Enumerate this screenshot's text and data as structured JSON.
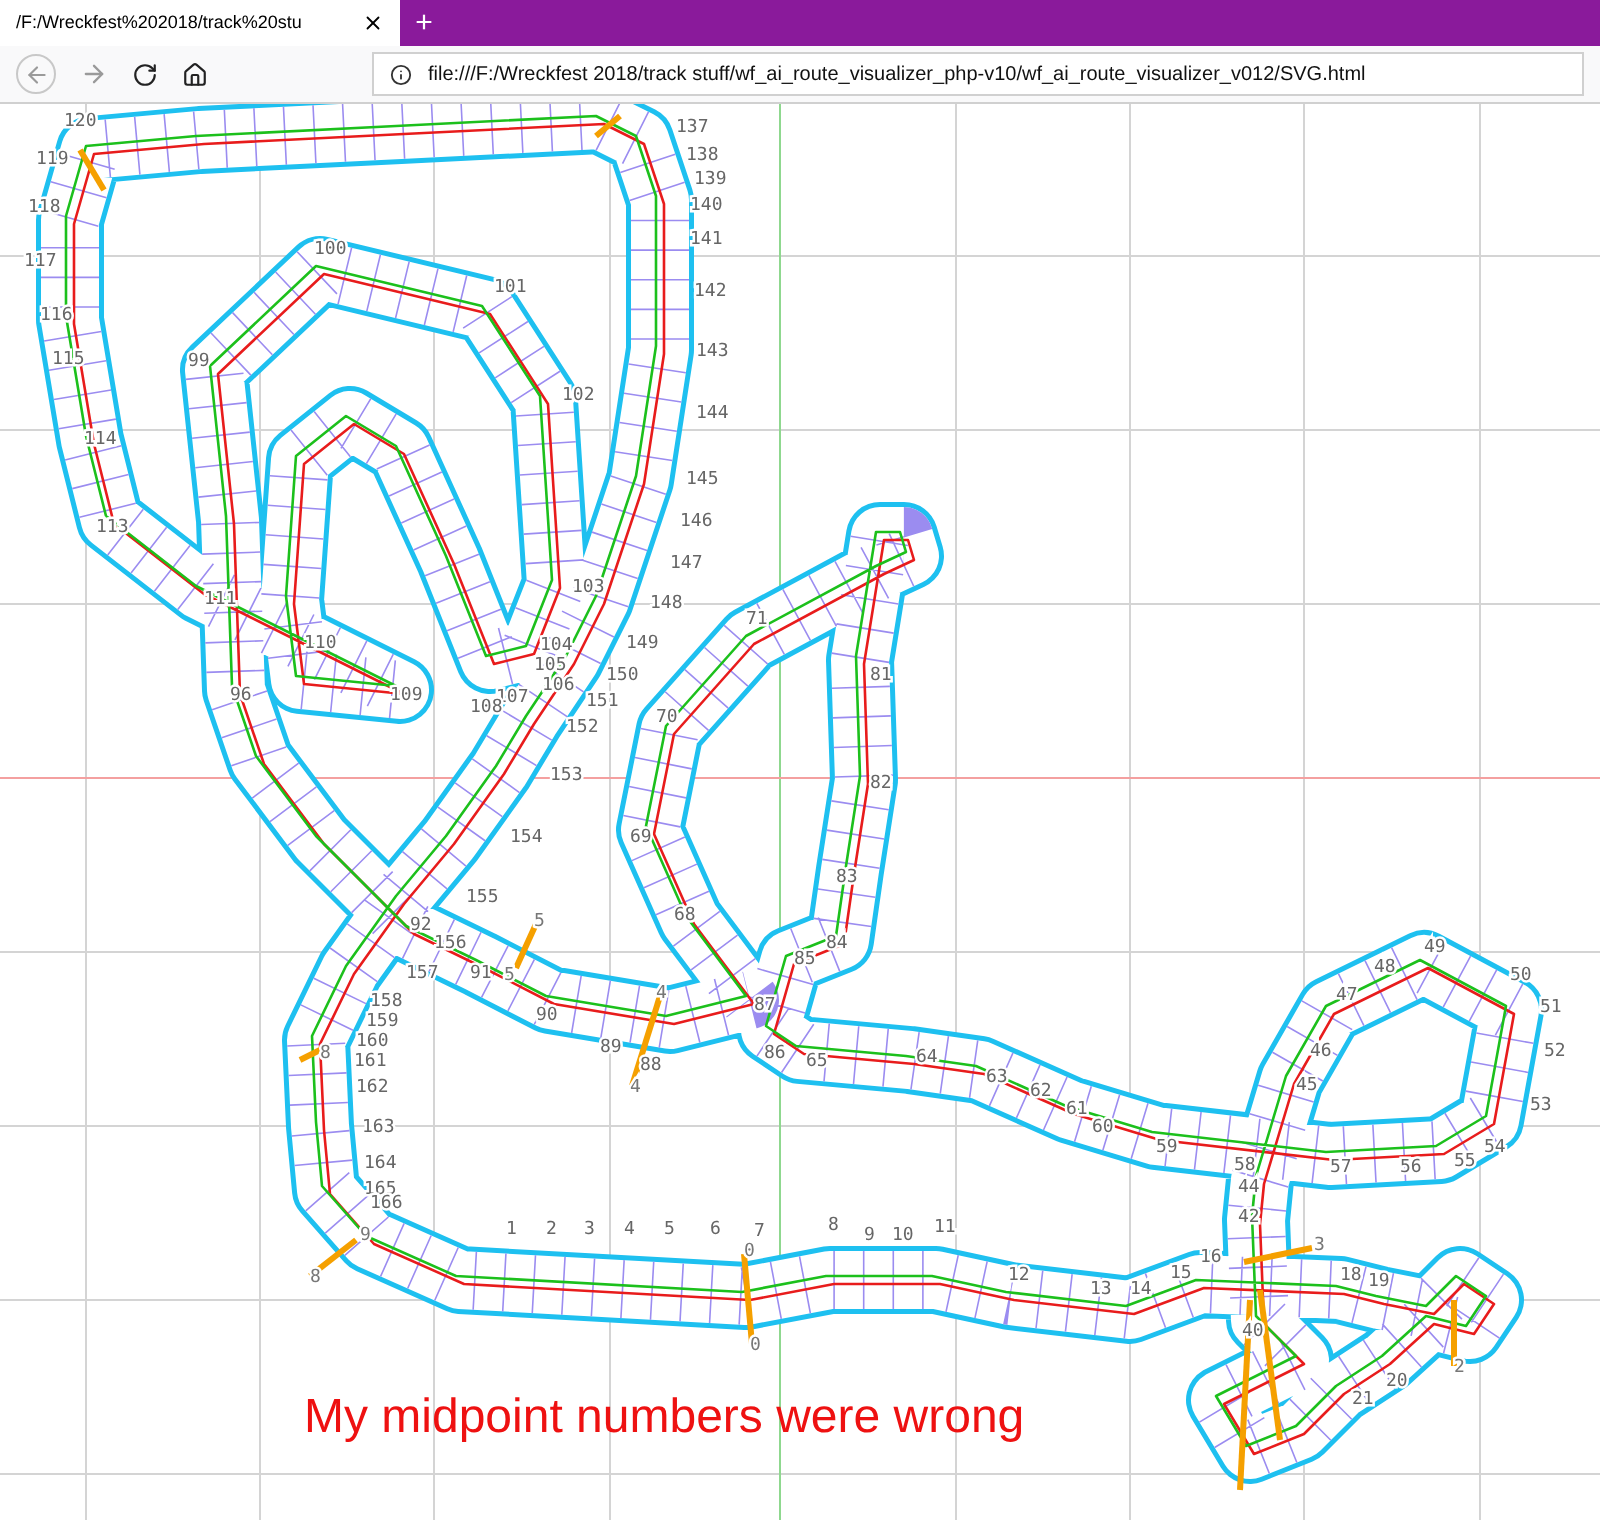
{
  "browser": {
    "tab": {
      "title": "/F:/Wreckfest%202018/track%20stu",
      "selected": true
    },
    "new_tab": "+",
    "url": "file:///F:/Wreckfest 2018/track stuff/wf_ai_route_visualizer_php-v10/wf_ai_route_visualizer_v012/SVG.html"
  },
  "visualizer": {
    "node_labels": [
      "120",
      "119",
      "118",
      "117",
      "116",
      "115",
      "114",
      "113",
      "100",
      "101",
      "99",
      "102",
      "137",
      "138",
      "139",
      "140",
      "141",
      "142",
      "143",
      "144",
      "145",
      "146",
      "147",
      "148",
      "149",
      "150",
      "151",
      "152",
      "153",
      "103",
      "104",
      "105",
      "106",
      "107",
      "108",
      "109",
      "110",
      "111",
      "96",
      "154",
      "155",
      "156",
      "157",
      "92",
      "91",
      "90",
      "89",
      "88",
      "71",
      "70",
      "69",
      "68",
      "81",
      "82",
      "83",
      "84",
      "85",
      "87",
      "86",
      "65",
      "64",
      "63",
      "62",
      "61",
      "60",
      "59",
      "58",
      "57",
      "56",
      "55",
      "54",
      "53",
      "52",
      "51",
      "50",
      "49",
      "48",
      "47",
      "46",
      "45",
      "158",
      "159",
      "160",
      "161",
      "162",
      "163",
      "164",
      "165",
      "166",
      "1",
      "2",
      "3",
      "4",
      "5",
      "6",
      "7",
      "8",
      "9",
      "10",
      "11",
      "12",
      "13",
      "14",
      "15",
      "16",
      "18",
      "19",
      "20",
      "21",
      "44",
      "42",
      "40"
    ],
    "marker_labels": [
      "5",
      "5",
      "4",
      "4",
      "0",
      "0",
      "3",
      "2",
      "8",
      "9",
      "8"
    ],
    "caption": "My midpoint numbers were wrong"
  }
}
